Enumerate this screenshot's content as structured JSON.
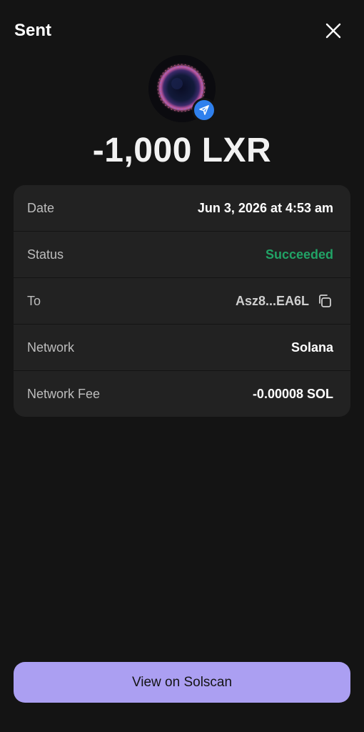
{
  "header": {
    "title": "Sent",
    "close_icon": "close-icon"
  },
  "token": {
    "avatar_icon": "token-avatar",
    "badge_icon": "paper-plane-icon",
    "badge_color": "#2f80ed",
    "amount": "-1,000 LXR"
  },
  "details": {
    "rows": [
      {
        "label": "Date",
        "value": "Jun 3, 2026 at 4:53 am"
      },
      {
        "label": "Status",
        "value": "Succeeded",
        "color": "#21a366"
      },
      {
        "label": "To",
        "value": "Asz8...EA6L",
        "icon": "copy-icon"
      },
      {
        "label": "Network",
        "value": "Solana"
      },
      {
        "label": "Network Fee",
        "value": "-0.00008 SOL"
      }
    ]
  },
  "footer": {
    "button_label": "View on Solscan",
    "button_color": "#ab9ff2"
  }
}
